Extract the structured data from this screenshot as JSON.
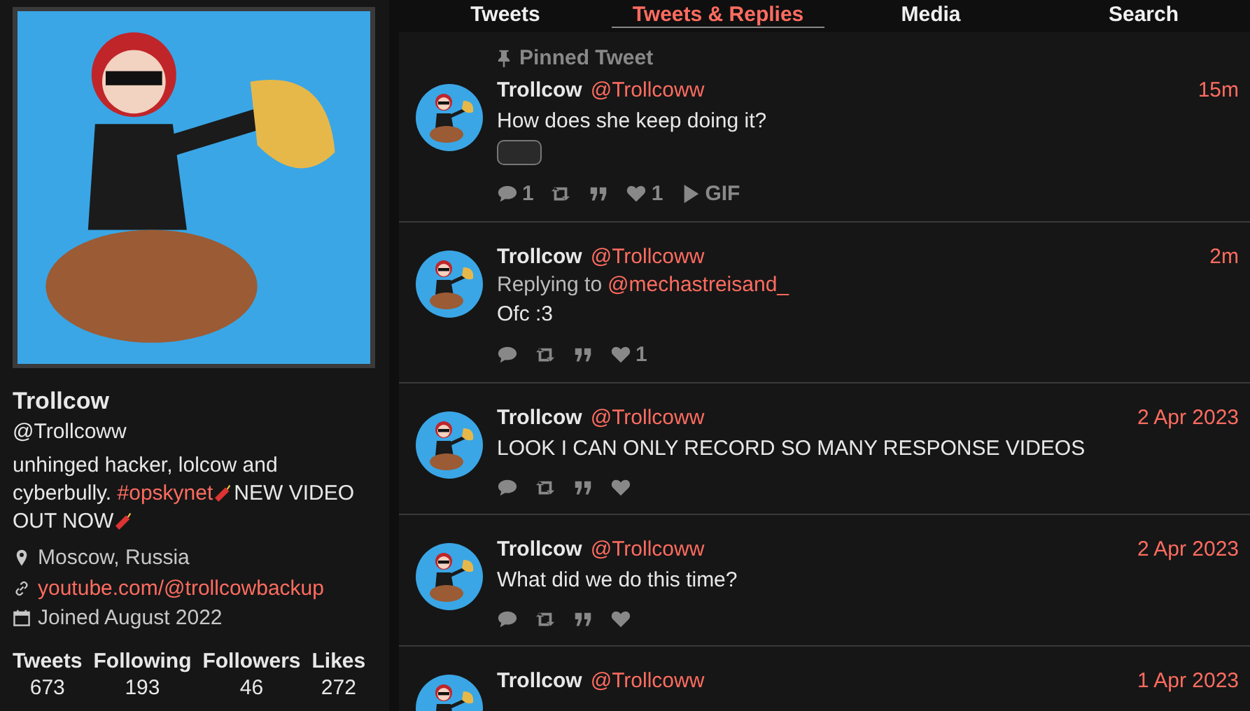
{
  "profile": {
    "name": "Trollcow",
    "handle": "@Trollcoww",
    "bio": [
      {
        "kind": "text",
        "text": "unhinged hacker, lolcow and cyberbully. "
      },
      {
        "kind": "hashtag",
        "text": "#opskynet"
      },
      {
        "kind": "firecracker"
      },
      {
        "kind": "text",
        "text": "NEW VIDEO OUT NOW"
      },
      {
        "kind": "firecracker"
      }
    ],
    "details": [
      {
        "kind": "location",
        "text": "Moscow, Russia"
      },
      {
        "kind": "website",
        "text": "youtube.com/@trollcowbackup"
      },
      {
        "kind": "joined",
        "text": "Joined August 2022"
      }
    ],
    "stats": [
      {
        "label": "Tweets",
        "value": "673"
      },
      {
        "label": "Following",
        "value": "193"
      },
      {
        "label": "Followers",
        "value": "46"
      },
      {
        "label": "Likes",
        "value": "272"
      }
    ]
  },
  "tabs": [
    {
      "label": "Tweets",
      "selected": false
    },
    {
      "label": "Tweets & Replies",
      "selected": true
    },
    {
      "label": "Media",
      "selected": false
    },
    {
      "label": "Search",
      "selected": false
    }
  ],
  "tweets": [
    {
      "pinned_label": "Pinned Tweet",
      "name": "Trollcow",
      "handle": "@Trollcoww",
      "date": "15m",
      "text": "How does she keep doing it?",
      "gif_thumbnail": true,
      "stats": [
        {
          "kind": "comment",
          "count": "1"
        },
        {
          "kind": "retweet"
        },
        {
          "kind": "quote"
        },
        {
          "kind": "heart",
          "count": "1"
        },
        {
          "kind": "play",
          "count": "GIF"
        }
      ]
    },
    {
      "name": "Trollcow",
      "handle": "@Trollcoww",
      "date": "2m",
      "reply_prefix": "Replying to",
      "reply_to": "@mechastreisand_",
      "text": "Ofc :3",
      "stats": [
        {
          "kind": "comment"
        },
        {
          "kind": "retweet"
        },
        {
          "kind": "quote"
        },
        {
          "kind": "heart",
          "count": "1"
        }
      ]
    },
    {
      "name": "Trollcow",
      "handle": "@Trollcoww",
      "date": "2 Apr 2023",
      "text": "LOOK I CAN ONLY RECORD SO MANY RESPONSE VIDEOS",
      "stats": [
        {
          "kind": "comment"
        },
        {
          "kind": "retweet"
        },
        {
          "kind": "quote"
        },
        {
          "kind": "heart"
        }
      ]
    },
    {
      "name": "Trollcow",
      "handle": "@Trollcoww",
      "date": "2 Apr 2023",
      "text": "What did we do this time?",
      "stats": [
        {
          "kind": "comment"
        },
        {
          "kind": "retweet"
        },
        {
          "kind": "quote"
        },
        {
          "kind": "heart"
        }
      ]
    },
    {
      "name": "Trollcow",
      "handle": "@Trollcoww",
      "date": "1 Apr 2023"
    }
  ]
}
